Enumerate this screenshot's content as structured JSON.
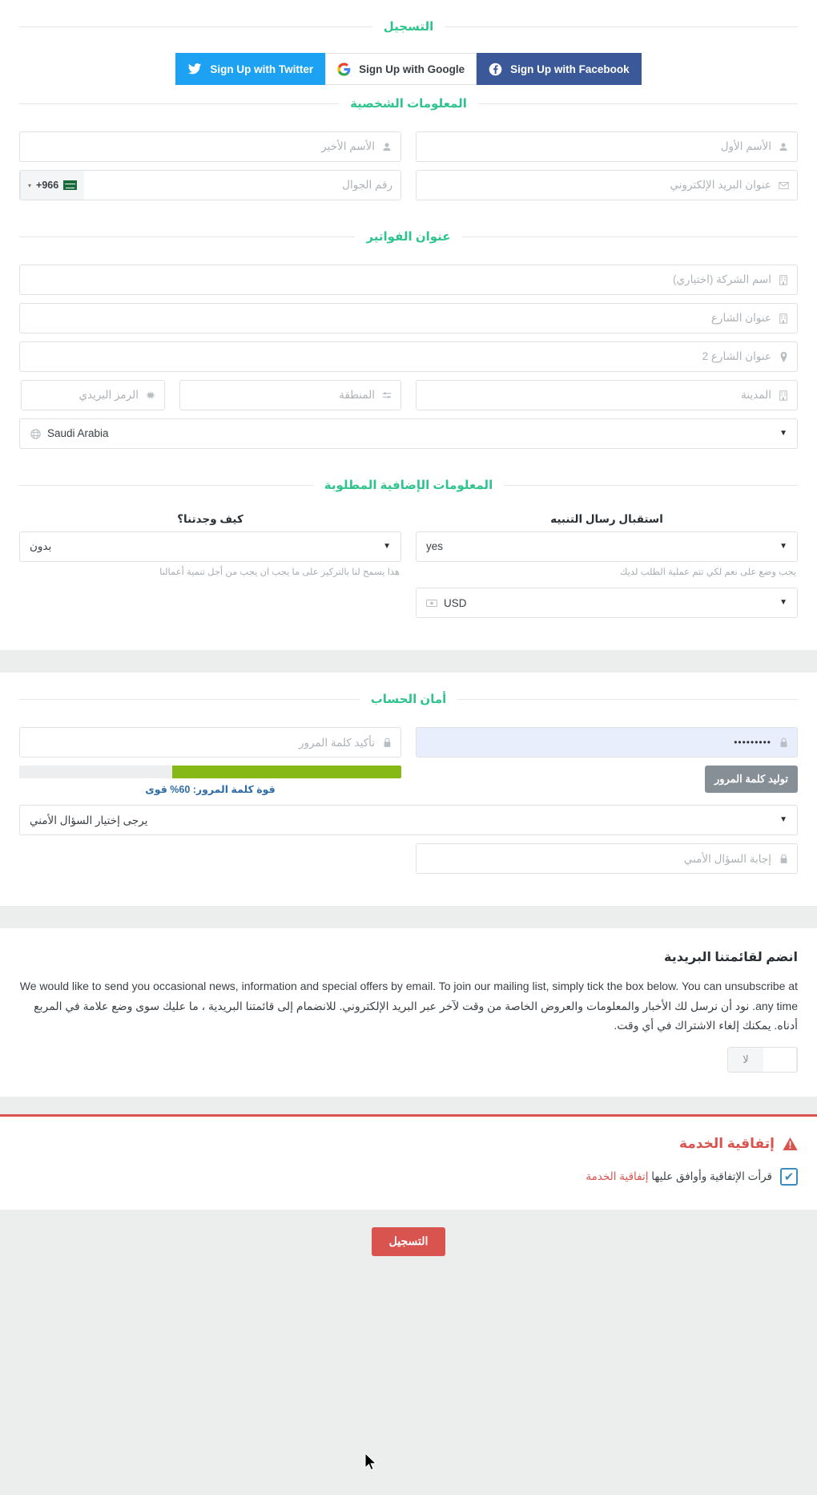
{
  "sections": {
    "register": {
      "legend": "التسجيل"
    },
    "personal": {
      "legend": "المعلومات الشخصية"
    },
    "billing": {
      "legend": "عنوان الفواتير"
    },
    "additional": {
      "legend": "المعلومات الإضافية المطلوبة"
    },
    "security": {
      "legend": "أمان الحساب"
    }
  },
  "social": {
    "twitter": {
      "label": "Sign Up with Twitter",
      "icon": "twitter-icon",
      "color": "#1da1f2"
    },
    "google": {
      "label": "Sign Up with Google",
      "icon": "google-icon",
      "color": "#ffffff"
    },
    "facebook": {
      "label": "Sign Up with Facebook",
      "icon": "facebook-icon",
      "color": "#3b5998"
    }
  },
  "personal": {
    "first_name_placeholder": "الأسم الأول",
    "last_name_placeholder": "الأسم الأخير",
    "email_placeholder": "عنوان البريد الإلكتروني",
    "phone_placeholder": "رقم الجوال",
    "phone_code": "+966",
    "phone_flag": "SA"
  },
  "billing": {
    "company_placeholder": "اسم الشركة (اختياري)",
    "address1_placeholder": "عنوان الشارع",
    "address2_placeholder": "عنوان الشارع 2",
    "city_placeholder": "المدينة",
    "region_placeholder": "المنطقة",
    "postcode_placeholder": "الرمز البريدي",
    "country_value": "Saudi Arabia"
  },
  "additional": {
    "notify_label": "استقبال رسال التنبيه",
    "notify_value": "yes",
    "notify_help": "يجب وضع على نعم لكي تتم عملية الطلب لديك",
    "howfound_label": "كيف وجدتنا؟",
    "howfound_value": "بدون",
    "howfound_help": "هذا يسمح لنا بالتركيز على ما يجب ان يجب من أجل تنمية أعمالنا",
    "currency_value": "USD"
  },
  "security": {
    "password_value": "•••••••••",
    "confirm_placeholder": "تأكيد كلمة المرور",
    "generate_label": "توليد كلمة المرور",
    "strength_text": "قوة كلمة المرور: 60% قوى",
    "strength_percent": 60,
    "strength_color": "#86b916",
    "question_value": "يرجى إختيار السؤال الأمني",
    "answer_placeholder": "إجابة السؤال الأمني"
  },
  "mailing": {
    "title": "انضم لقائمتنا البريدية",
    "body": "We would like to send you occasional news, information and special offers by email. To join our mailing list, simply tick the box below. You can unsubscribe at any time. نود أن نرسل لك الأخبار والمعلومات والعروض الخاصة من وقت لآخر عبر البريد الإلكتروني. للانضمام إلى قائمتنا البريدية ، ما عليك سوى وضع علامة في المربع أدناه. يمكنك إلغاء الاشتراك في أي وقت.",
    "toggle_no": "لا",
    "toggle_blank": ""
  },
  "tos": {
    "title": "إتفاقية الخدمة",
    "checkbox_mark": "✔",
    "agree_text_before": "قرأت الإتفاقية وأوافق عليها",
    "agree_link": "إتفاقية الخدمة"
  },
  "submit": {
    "label": "التسجيل"
  },
  "icons": {
    "user": "user-icon",
    "envelope": "envelope-icon",
    "building": "building-icon",
    "map_pin": "map-pin-icon",
    "sliders": "sliders-icon",
    "asterisk": "asterisk-icon",
    "globe": "globe-icon",
    "money": "money-icon",
    "lock": "lock-icon",
    "caret": "▼",
    "warning": "warning-icon"
  }
}
